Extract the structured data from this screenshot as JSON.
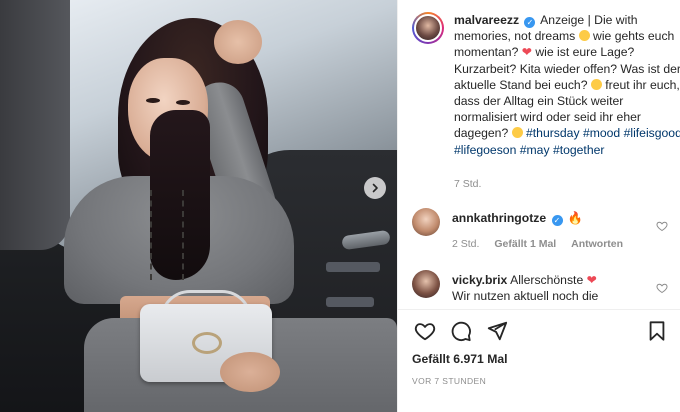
{
  "post": {
    "username": "malvareezz",
    "caption_parts": {
      "text1": "Anzeige | Die with memories, not dreams",
      "text2": "wie gehts euch momentan?",
      "text3": "wie ist eure Lage? Kurzarbeit? Kita wieder offen? Was ist der aktuelle Stand bei euch?",
      "text4": "freut ihr euch, dass der Alltag ein Stück weiter normalisiert wird oder seid ihr eher dagegen?",
      "hashtags": [
        "#thursday",
        "#mood",
        "#lifeisgood",
        "#lifegoeson",
        "#may",
        "#together"
      ]
    },
    "caption_time": "7 Std."
  },
  "comments": [
    {
      "username": "annkathringotze",
      "text": "",
      "time": "2 Std.",
      "likes": "Gefällt 1 Mal",
      "reply": "Antworten"
    },
    {
      "username": "vicky.brix",
      "text": "Allerschönste",
      "text_line2": "Wir nutzen aktuell noch die"
    }
  ],
  "footer": {
    "likes": "Gefällt 6.971 Mal",
    "time": "VOR 7 STUNDEN"
  },
  "icons": {
    "verified": "verified-badge-icon",
    "like": "heart-outline-icon",
    "comment": "speech-bubble-icon",
    "share": "paper-plane-icon",
    "save": "bookmark-icon",
    "next": "chevron-right-icon"
  },
  "colors": {
    "verified": "#3897f0",
    "hashtag": "#00376b",
    "heart": "#ed4956",
    "muted": "#8e8e8e"
  }
}
